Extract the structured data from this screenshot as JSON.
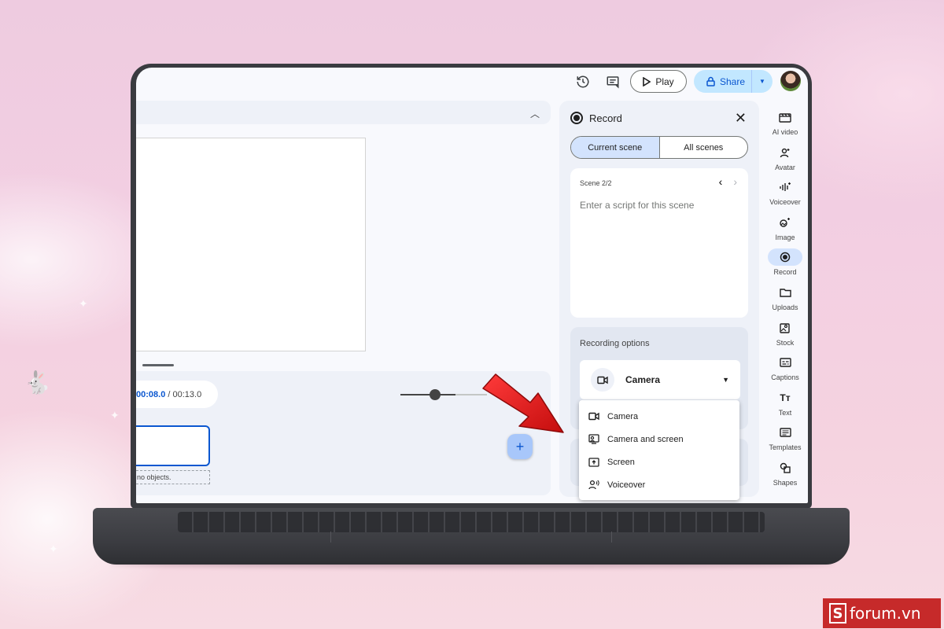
{
  "topbar": {
    "play_label": "Play",
    "share_label": "Share"
  },
  "timeline": {
    "current_time": "00:08.0",
    "separator": " / ",
    "total_time": "00:13.0",
    "no_objects_text": "no objects."
  },
  "record_panel": {
    "title": "Record",
    "tabs": [
      "Current scene",
      "All scenes"
    ],
    "scene_label": "Scene 2/2",
    "script_placeholder": "Enter a script for this scene",
    "recording_options_label": "Recording options",
    "selected_option": "Camera"
  },
  "dropdown": {
    "items": [
      "Camera",
      "Camera and screen",
      "Screen",
      "Voiceover"
    ]
  },
  "rail": {
    "items": [
      {
        "label": "AI video",
        "icon": "ai-video-icon"
      },
      {
        "label": "Avatar",
        "icon": "avatar-icon"
      },
      {
        "label": "Voiceover",
        "icon": "voiceover-icon"
      },
      {
        "label": "Image",
        "icon": "image-icon"
      },
      {
        "label": "Record",
        "icon": "record-icon"
      },
      {
        "label": "Uploads",
        "icon": "folder-icon"
      },
      {
        "label": "Stock",
        "icon": "stock-icon"
      },
      {
        "label": "Captions",
        "icon": "captions-icon"
      },
      {
        "label": "Text",
        "icon": "text-icon"
      },
      {
        "label": "Templates",
        "icon": "templates-icon"
      },
      {
        "label": "Shapes",
        "icon": "shapes-icon"
      }
    ],
    "active": "Record"
  },
  "watermark": {
    "letter": "S",
    "text": "forum.vn"
  },
  "colors": {
    "accent": "#0b57d0",
    "share_bg": "#c2e7ff",
    "selected_tab": "#d3e3fd",
    "arrow": "#e11b1b",
    "watermark": "#c62a2a"
  }
}
